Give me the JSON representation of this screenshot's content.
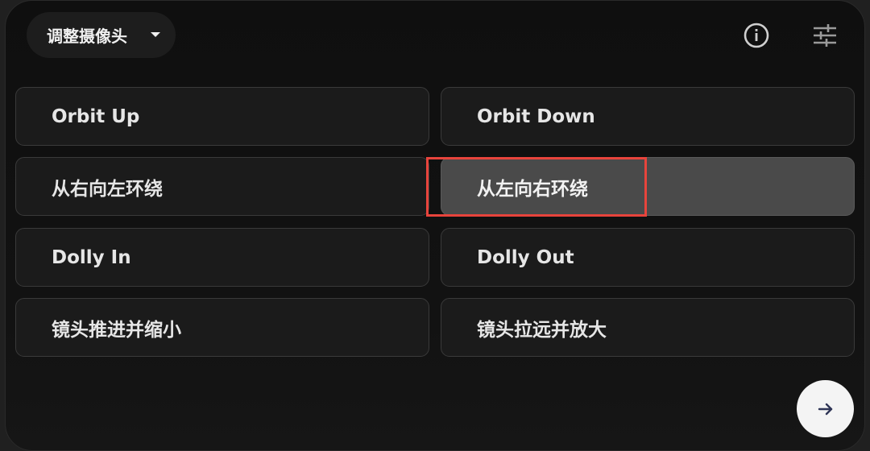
{
  "header": {
    "dropdown_label": "调整摄像头",
    "info_icon": "info-icon",
    "settings_icon": "tune-sliders-icon"
  },
  "options": [
    {
      "label": "Orbit Up",
      "selected": false
    },
    {
      "label": "Orbit Down",
      "selected": false
    },
    {
      "label": "从右向左环绕",
      "selected": false
    },
    {
      "label": "从左向右环绕",
      "selected": true
    },
    {
      "label": "Dolly In",
      "selected": false
    },
    {
      "label": "Dolly Out",
      "selected": false
    },
    {
      "label": "镜头推进并缩小",
      "selected": false
    },
    {
      "label": "镜头拉远并放大",
      "selected": false
    }
  ],
  "next_button": {
    "icon": "arrow-right-icon"
  },
  "colors": {
    "highlight": "#e8443c",
    "selected_bg": "#4a4a4a",
    "panel_bg": "#0f0f0f"
  }
}
